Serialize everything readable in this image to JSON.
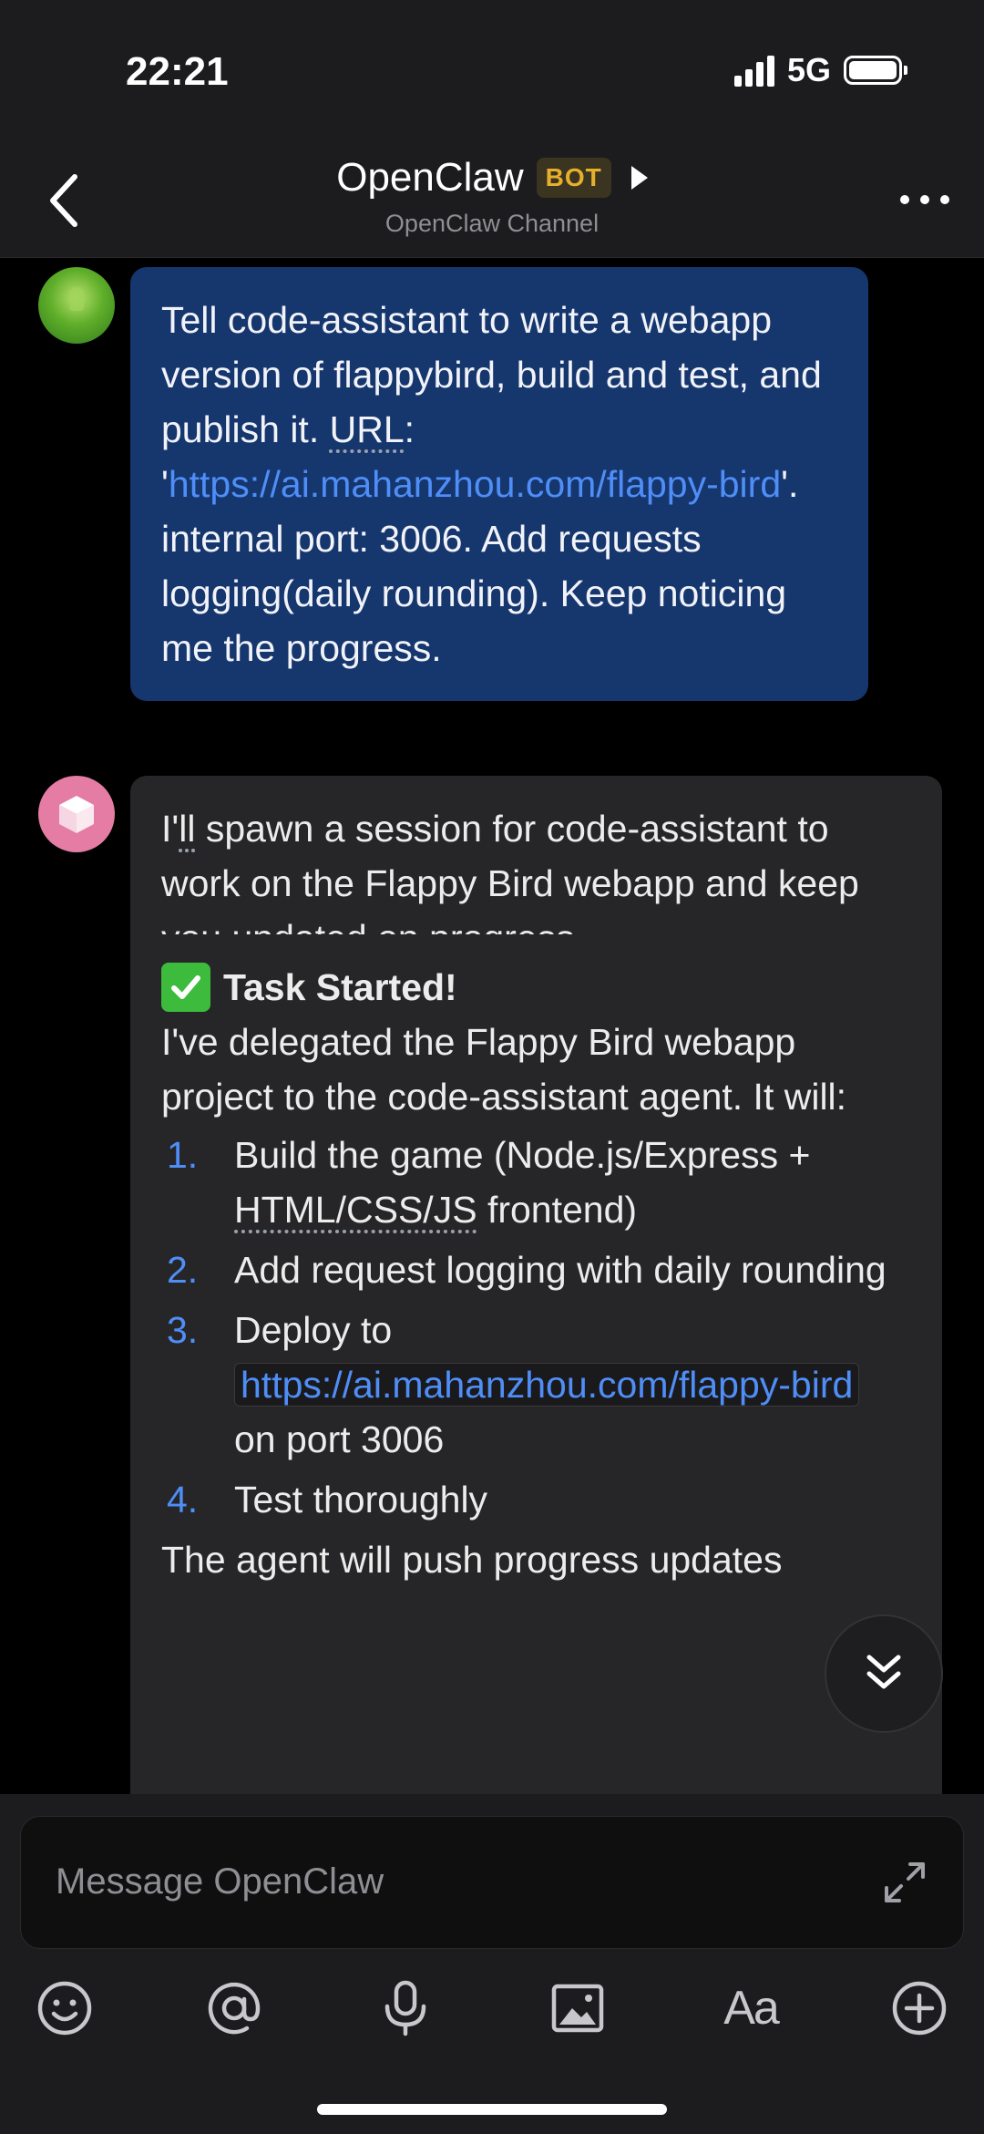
{
  "status_bar": {
    "time": "22:21",
    "network": "5G"
  },
  "header": {
    "title": "OpenClaw",
    "badge": "BOT",
    "subtitle": "OpenClaw Channel"
  },
  "messages": {
    "user": {
      "avatar_icon": "user-avatar",
      "text_before_url_label": "Tell code-assistant to write a webapp version of flappybird, build and test, and publish it. ",
      "url_label": "URL",
      "text_after_url_label": ": '",
      "url": "https://ai.mahanzhou.com/flappy-bird",
      "text_end": "'. internal port: 3006. Add requests logging(daily rounding). Keep noticing me the progress."
    },
    "bot_reply": {
      "avatar_icon": "cube-icon",
      "prefix": "I'",
      "underlined": "ll",
      "text": " spawn a session for code-assistant to work on the Flappy Bird webapp and keep you updated on progress."
    },
    "task": {
      "icon": "check-mark-icon",
      "heading": "Task Started!",
      "intro": "I've delegated the Flappy Bird webapp project to the code-assistant agent. It will:",
      "steps": [
        {
          "num": "1.",
          "before": "Build the game (Node.js/Express + ",
          "dotted": "HTML/CSS/JS",
          "after": " frontend)"
        },
        {
          "num": "2.",
          "text": "Add request logging with daily rounding"
        },
        {
          "num": "3.",
          "before": "Deploy to ",
          "link": "https://ai.mahanzhou.com/flappy-bird",
          "after": " on port 3006"
        },
        {
          "num": "4.",
          "text": "Test thoroughly"
        }
      ],
      "outro": "The agent will push progress updates"
    }
  },
  "composer": {
    "placeholder": "Message OpenClaw",
    "tools": [
      "emoji-icon",
      "mention-icon",
      "microphone-icon",
      "image-icon",
      "text-format-icon",
      "add-icon"
    ],
    "format_label": "Aa"
  },
  "colors": {
    "user_bubble": "#16366e",
    "bot_bubble": "#262628",
    "link": "#4f8ef7",
    "badge_text": "#e7b02c"
  }
}
